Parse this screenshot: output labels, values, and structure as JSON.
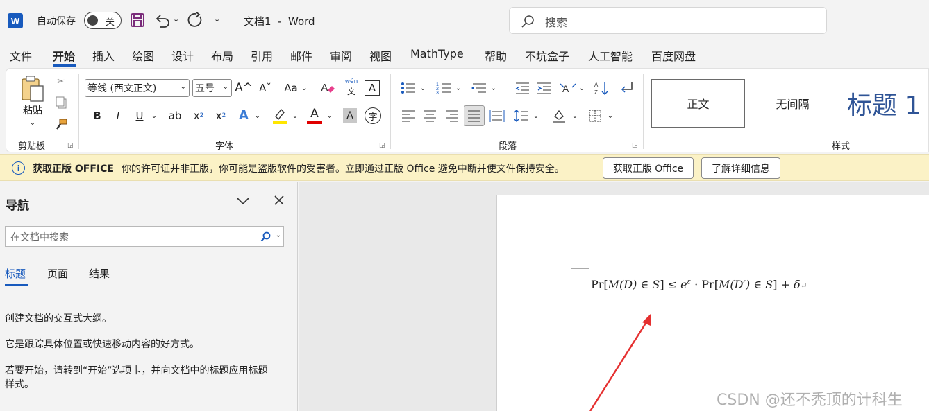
{
  "titlebar": {
    "app_icon": "W",
    "autosave_label": "自动保存",
    "autosave_state": "关",
    "doc_title": "文档1  -  Word",
    "search_placeholder": "搜索"
  },
  "menu": [
    "文件",
    "开始",
    "插入",
    "绘图",
    "设计",
    "布局",
    "引用",
    "邮件",
    "审阅",
    "视图",
    "MathType",
    "帮助",
    "不坑盒子",
    "人工智能",
    "百度网盘"
  ],
  "ribbon": {
    "clipboard": {
      "paste_label": "粘贴",
      "group_label": "剪贴板"
    },
    "font": {
      "font_name": "等线 (西文正文)",
      "font_size": "五号",
      "grow": "A^",
      "shrink": "Aˇ",
      "case": "Aa",
      "phonetic_top": "wén",
      "phonetic_bottom": "文",
      "border_char": "A",
      "bold": "B",
      "italic": "I",
      "underline": "U",
      "strike": "ab",
      "subscript": "x",
      "sub_mark": "2",
      "superscript": "x",
      "sup_mark": "2",
      "effects": "A",
      "font_color": "A",
      "shading": "A",
      "enclose": "字",
      "group_label": "字体"
    },
    "paragraph": {
      "group_label": "段落"
    },
    "styles": {
      "items": [
        "正文",
        "无间隔",
        "标题 1"
      ],
      "group_label": "样式"
    }
  },
  "infobar": {
    "title": "获取正版 OFFICE",
    "message": "你的许可证并非正版，你可能是盗版软件的受害者。立即通过正版 Office 避免中断并使文件保持安全。",
    "button1": "获取正版 Office",
    "button2": "了解详细信息"
  },
  "nav": {
    "title": "导航",
    "search_placeholder": "在文档中搜索",
    "tabs": [
      "标题",
      "页面",
      "结果"
    ],
    "text1": "创建文档的交互式大纲。",
    "text2": "它是跟踪具体位置或快速移动内容的好方式。",
    "text3a": "若要开始，请转到“开始”选项卡，并向文档中的标题应用标题",
    "text3b": "样式。"
  },
  "document": {
    "formula": {
      "pr1": "Pr[",
      "m1": "M",
      "arg1": "(D)",
      "in1": " ∈ ",
      "s1": "S",
      "close1": "]",
      "le": " ≤ ",
      "e": "e",
      "eps": "ε",
      "dot": " · ",
      "pr2": "Pr[",
      "m2": "M",
      "arg2": "(D′)",
      "in2": " ∈ ",
      "s2": "S",
      "close2": "]",
      "plus": " + ",
      "delta": "δ"
    }
  },
  "watermark": "CSDN @还不秃顶的计科生",
  "colors": {
    "accent": "#185abd",
    "infobar": "#fbf2c6",
    "arrow": "#e53030"
  }
}
